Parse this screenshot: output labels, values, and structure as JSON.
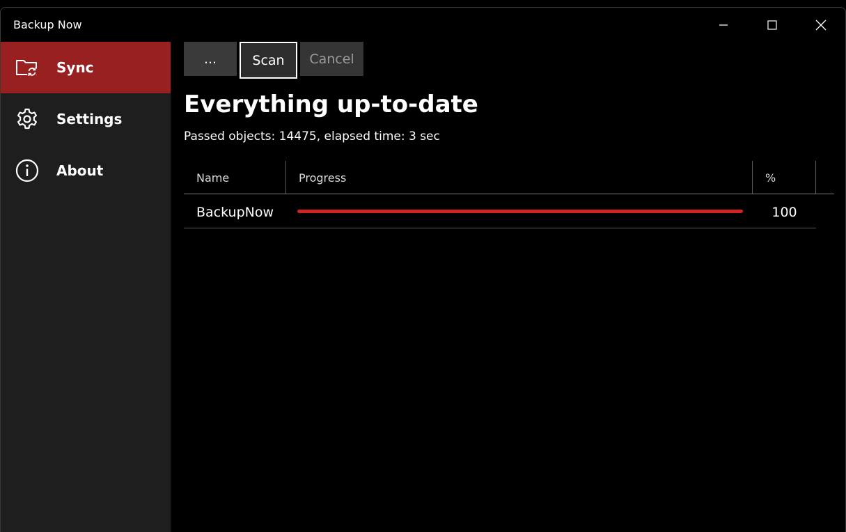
{
  "window": {
    "title": "Backup Now"
  },
  "sidebar": {
    "items": [
      {
        "label": "Sync",
        "icon": "folder-sync-icon",
        "active": true
      },
      {
        "label": "Settings",
        "icon": "gear-icon",
        "active": false
      },
      {
        "label": "About",
        "icon": "info-icon",
        "active": false
      }
    ]
  },
  "toolbar": {
    "more_label": "...",
    "scan_label": "Scan",
    "cancel_label": "Cancel"
  },
  "status": {
    "heading": "Everything up-to-date",
    "details": "Passed objects: 14475, elapsed time: 3 sec"
  },
  "table": {
    "columns": [
      "Name",
      "Progress",
      "%"
    ],
    "rows": [
      {
        "name": "BackupNow",
        "progress": 100,
        "percent": "100"
      }
    ]
  },
  "colors": {
    "accent": "#982020",
    "progress": "#d42323"
  }
}
